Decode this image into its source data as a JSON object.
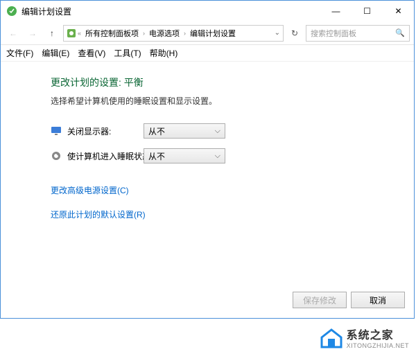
{
  "window": {
    "title": "编辑计划设置"
  },
  "winbtn": {
    "min": "—",
    "max": "☐",
    "close": "✕"
  },
  "breadcrumbs": {
    "b1": "所有控制面板项",
    "b2": "电源选项",
    "b3": "编辑计划设置"
  },
  "search": {
    "placeholder": "搜索控制面板"
  },
  "menu": {
    "file": "文件(F)",
    "edit": "编辑(E)",
    "view": "查看(V)",
    "tools": "工具(T)",
    "help": "帮助(H)"
  },
  "heading": "更改计划的设置: 平衡",
  "subtext": "选择希望计算机使用的睡眠设置和显示设置。",
  "rows": {
    "display": {
      "label": "关闭显示器:",
      "value": "从不"
    },
    "sleep": {
      "label": "使计算机进入睡眠状态:",
      "value": "从不"
    }
  },
  "links": {
    "advanced": "更改高级电源设置(C)",
    "restore": "还原此计划的默认设置(R)"
  },
  "buttons": {
    "save": "保存修改",
    "cancel": "取消"
  },
  "watermark": {
    "name": "系统之家",
    "url": "XITONGZHIJIA.NET"
  }
}
